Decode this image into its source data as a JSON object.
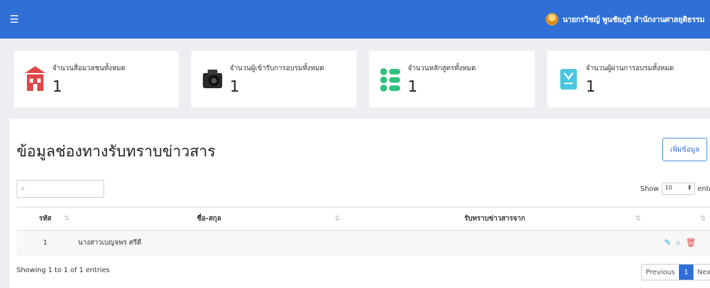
{
  "header": {
    "menu_icon": "hamburger-icon",
    "user_name": "นายกรวิชญ์ พูนชัยภูมิ สำนักงานศาลยุติธรรม",
    "brand_color": "#2f6fd6"
  },
  "cards": [
    {
      "label": "จำนวนสื่อมวลชนทั้งหมด",
      "count": "1",
      "icon": "building-icon",
      "color": "#e04848"
    },
    {
      "label": "จำนวนผู้เข้ารับการอบรมทั้งหมด",
      "count": "1",
      "icon": "camera-icon",
      "color": "#222222"
    },
    {
      "label": "จำนวนหลักสูตรทั้งหมด",
      "count": "1",
      "icon": "list-icon",
      "color": "#2ec27e"
    },
    {
      "label": "จำนวนผู้ผ่านการอบรมทั้งหมด",
      "count": "1",
      "icon": "certificate-icon",
      "color": "#4ac6e0"
    }
  ],
  "panel": {
    "title": "ข้อมูลช่องทางรับทราบข่าวสาร",
    "add_button": "เพิ่มข้อมูล",
    "search_placeholder": "",
    "show_label": "Show",
    "page_size": "10",
    "entries_label": "entries",
    "columns": [
      "รหัส",
      "ชื่อ-สกุล",
      "รับทราบข่าวสารจาก",
      ""
    ],
    "rows": [
      {
        "id": "1",
        "name": "นางสาวเบญจพร ศรีดี",
        "source": ""
      }
    ],
    "info": "Showing 1 to 1 of 1 entries",
    "pagination": {
      "previous": "Previous",
      "current": "1",
      "next": "Next"
    }
  }
}
